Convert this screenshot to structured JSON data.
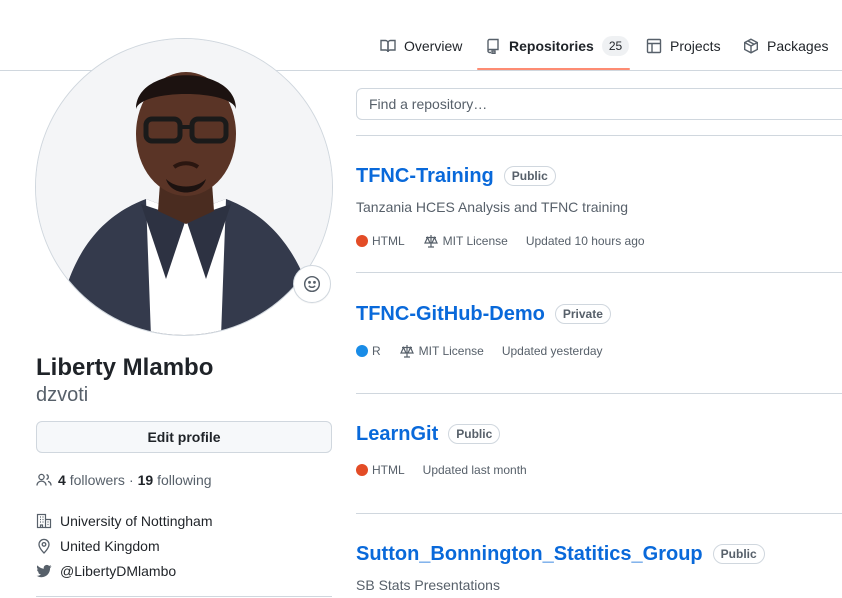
{
  "tabs": [
    {
      "label": "Overview",
      "icon": "book-icon"
    },
    {
      "label": "Repositories",
      "icon": "repo-icon",
      "count": "25",
      "active": true
    },
    {
      "label": "Projects",
      "icon": "table-icon"
    },
    {
      "label": "Packages",
      "icon": "package-icon"
    }
  ],
  "profile": {
    "name": "Liberty Mlambo",
    "username": "dzvoti",
    "edit_label": "Edit profile",
    "followers_count": "4",
    "followers_label": "followers",
    "separator": "·",
    "following_count": "19",
    "following_label": "following",
    "organization": "University of Nottingham",
    "location": "United Kingdom",
    "twitter": "@LibertyDMlambo"
  },
  "search": {
    "placeholder": "Find a repository…"
  },
  "repos": [
    {
      "name": "TFNC-Training",
      "visibility": "Public",
      "description": "Tanzania HCES Analysis and TFNC training",
      "language": "HTML",
      "language_color": "#e34c26",
      "license": "MIT License",
      "updated": "Updated 10 hours ago"
    },
    {
      "name": "TFNC-GitHub-Demo",
      "visibility": "Private",
      "description": "",
      "language": "R",
      "language_color": "#198ce7",
      "license": "MIT License",
      "updated": "Updated yesterday"
    },
    {
      "name": "LearnGit",
      "visibility": "Public",
      "description": "",
      "language": "HTML",
      "language_color": "#e34c26",
      "license": "",
      "updated": "Updated last month"
    },
    {
      "name": "Sutton_Bonnington_Statitics_Group",
      "visibility": "Public",
      "description": "SB Stats Presentations",
      "language": "",
      "license": "",
      "updated": ""
    }
  ],
  "colors": {
    "link": "#0969da",
    "tab_underline": "#fd8c73",
    "twitter": "#1f2328"
  }
}
